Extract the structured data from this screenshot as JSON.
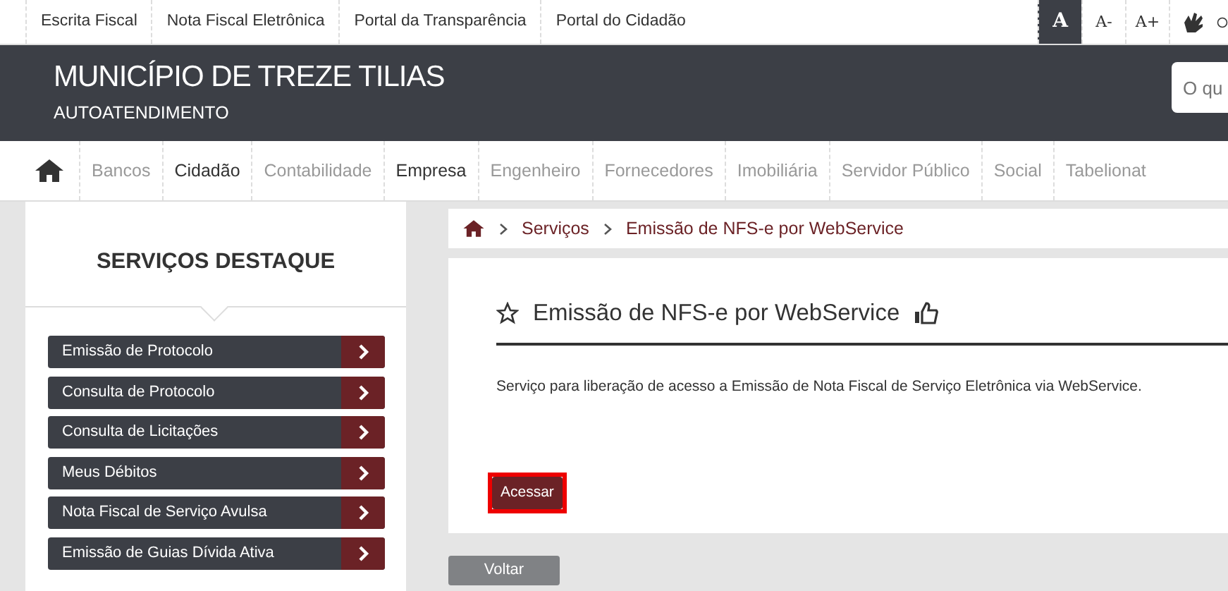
{
  "top_links": [
    "Escrita Fiscal",
    "Nota Fiscal Eletrônica",
    "Portal da Transparência",
    "Portal do Cidadão"
  ],
  "font_controls": [
    {
      "label": "A",
      "selected": true
    },
    {
      "label": "A-",
      "selected": false
    },
    {
      "label": "A+",
      "selected": false
    }
  ],
  "header": {
    "title": "MUNICÍPIO DE TREZE TILIAS",
    "subtitle": "AUTOATENDIMENTO",
    "search": {
      "placeholder": "O qu"
    }
  },
  "nav": [
    {
      "label": "Bancos",
      "highlighted": false
    },
    {
      "label": "Cidadão",
      "highlighted": true
    },
    {
      "label": "Contabilidade",
      "highlighted": false
    },
    {
      "label": "Empresa",
      "highlighted": true
    },
    {
      "label": "Engenheiro",
      "highlighted": false
    },
    {
      "label": "Fornecedores",
      "highlighted": false
    },
    {
      "label": "Imobiliária",
      "highlighted": false
    },
    {
      "label": "Servidor Público",
      "highlighted": false
    },
    {
      "label": "Social",
      "highlighted": false
    },
    {
      "label": "Tabelionat",
      "highlighted": false
    }
  ],
  "sidebar": {
    "title": "SERVIÇOS DESTAQUE",
    "items": [
      "Emissão de Protocolo",
      "Consulta de Protocolo",
      "Consulta de Licitações",
      "Meus Débitos",
      "Nota Fiscal de Serviço Avulsa",
      "Emissão de Guias Dívida Ativa"
    ]
  },
  "breadcrumb": [
    "Serviços",
    "Emissão de NFS-e por WebService"
  ],
  "service": {
    "title": "Emissão de NFS-e por WebService",
    "description": "Serviço para liberação de acesso a Emissão de Nota Fiscal de Serviço Eletrônica via WebService.",
    "button": "Acessar",
    "button_highlighted": true
  },
  "back_button": "Voltar"
}
